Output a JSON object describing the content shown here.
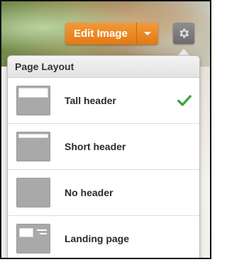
{
  "toolbar": {
    "edit_image_label": "Edit Image",
    "dropdown_icon": "caret-down-icon",
    "settings_icon": "gear-icon",
    "accent_color": "#e8831f"
  },
  "menu": {
    "title": "Page Layout",
    "items": [
      {
        "label": "Tall header",
        "icon": "tall-header-layout-icon",
        "selected": true
      },
      {
        "label": "Short header",
        "icon": "short-header-layout-icon",
        "selected": false
      },
      {
        "label": "No header",
        "icon": "no-header-layout-icon",
        "selected": false
      },
      {
        "label": "Landing page",
        "icon": "landing-page-layout-icon",
        "selected": false
      }
    ],
    "selected_icon": "checkmark-icon",
    "check_color": "#3ea33e"
  }
}
